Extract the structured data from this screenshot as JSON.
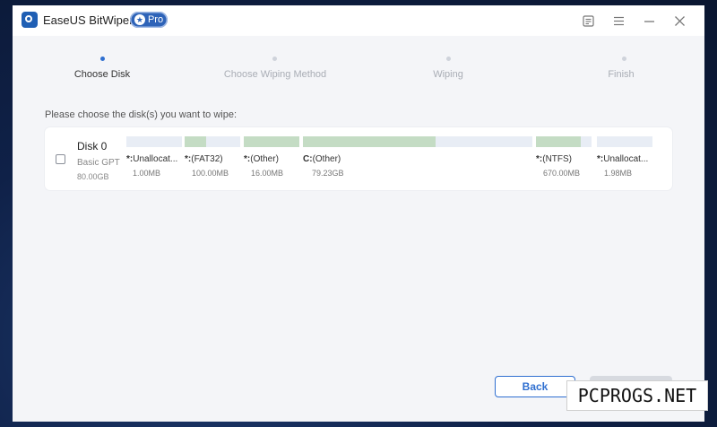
{
  "titlebar": {
    "app_title": "EaseUS BitWiper",
    "badge": "Pro",
    "icons": [
      "feedback-icon",
      "menu-icon",
      "minimize-icon",
      "close-icon"
    ]
  },
  "steps": [
    {
      "label": "Choose Disk",
      "active": true
    },
    {
      "label": "Choose Wiping Method",
      "active": false
    },
    {
      "label": "Wiping",
      "active": false
    },
    {
      "label": "Finish",
      "active": false
    }
  ],
  "instruction": "Please choose the disk(s) you want to wipe:",
  "disk": {
    "name": "Disk 0",
    "type": "Basic GPT",
    "size": "80.00GB",
    "partitions": [
      {
        "letter": "*:",
        "label": "Unallocat...",
        "size": "1.00MB",
        "used_fraction": 0
      },
      {
        "letter": "*:",
        "label": "(FAT32)",
        "size": "100.00MB",
        "used_fraction": 0.38
      },
      {
        "letter": "*:",
        "label": "(Other)",
        "size": "16.00MB",
        "used_fraction": 1
      },
      {
        "letter": "C:",
        "label": "(Other)",
        "size": "79.23GB",
        "used_fraction": 0.58
      },
      {
        "letter": "*:",
        "label": "(NTFS)",
        "size": "670.00MB",
        "used_fraction": 0.8
      },
      {
        "letter": "*:",
        "label": "Unallocat...",
        "size": "1.98MB",
        "used_fraction": 0
      }
    ]
  },
  "buttons": {
    "back": "Back",
    "next": ""
  },
  "watermark": "PCPROGS.NET",
  "colors": {
    "accent": "#2f6fd0",
    "partition_used": "#c4dcc4",
    "partition_free": "#e8edf5"
  }
}
